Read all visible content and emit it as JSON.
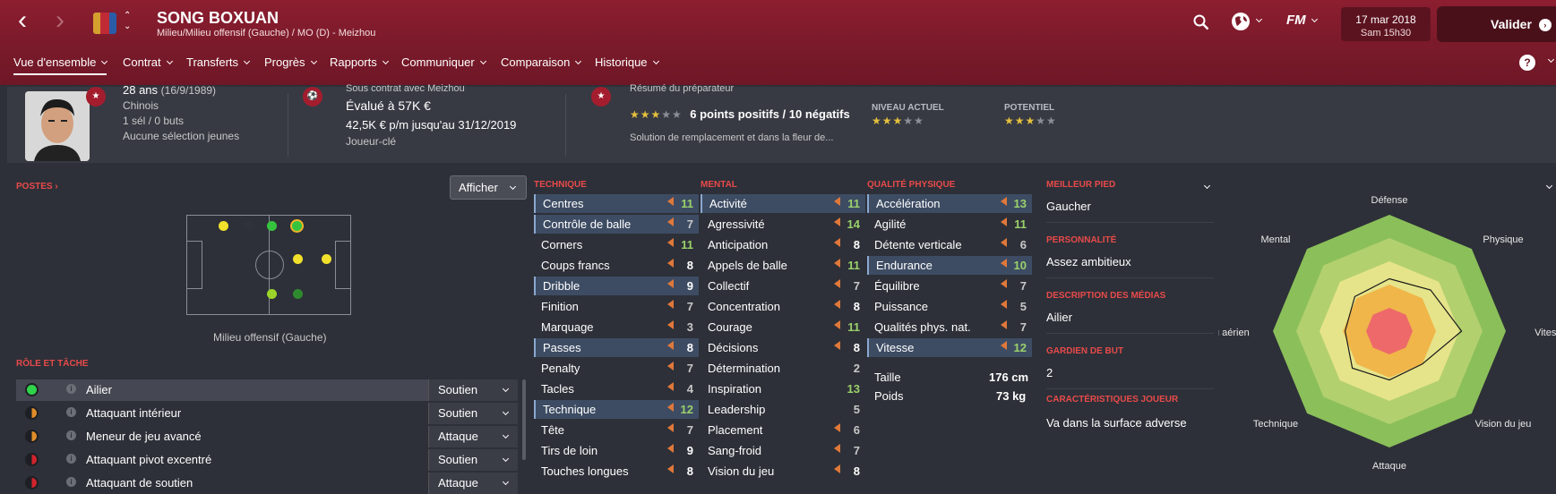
{
  "header": {
    "player_name": "SONG BOXUAN",
    "player_subtitle": "Milieu/Milieu offensif (Gauche) / MO (D) - Meizhou",
    "date": "17 mar 2018",
    "time": "Sam 15h30",
    "valider_label": "Valider",
    "fm_label": "FM",
    "help_label": "?"
  },
  "tabs": [
    "Vue d'ensemble",
    "Contrat",
    "Transferts",
    "Progrès",
    "Rapports",
    "Communiquer",
    "Comparaison",
    "Historique"
  ],
  "summary": {
    "age": "28 ans",
    "birth": "(16/9/1989)",
    "nationality": "Chinois",
    "caps": "1 sél / 0 buts",
    "youth_caps": "Aucune sélection jeunes",
    "contract_label": "Sous contrat avec Meizhou",
    "value": "Évalué à 57K €",
    "wage": "42,5K € p/m jusqu'au 31/12/2019",
    "status": "Joueur-clé",
    "coach_label": "Résumé du préparateur",
    "coach_points": "6 points positifs / 10 négatifs",
    "coach_note": "Solution de remplacement et dans la fleur de...",
    "current_level_label": "NIVEAU ACTUEL",
    "potential_label": "POTENTIEL",
    "coach_stars": 3,
    "current_stars": 3,
    "potential_stars": 3
  },
  "positions": {
    "header": "POSTES",
    "caption": "Milieu offensif (Gauche)",
    "afficher": "Afficher"
  },
  "roles": {
    "header": "RÔLE ET TÂCHE",
    "items": [
      {
        "name": "Ailier",
        "duty": "Soutien",
        "color": "#2fd44a"
      },
      {
        "name": "Attaquant intérieur",
        "duty": "Soutien",
        "color": "#e08c2a"
      },
      {
        "name": "Meneur de jeu avancé",
        "duty": "Attaque",
        "color": "#e08c2a"
      },
      {
        "name": "Attaquant pivot excentré",
        "duty": "Soutien",
        "color": "#d0242e"
      },
      {
        "name": "Attaquant de soutien",
        "duty": "Attaque",
        "color": "#d0242e"
      }
    ]
  },
  "technique": {
    "header": "TECHNIQUE",
    "items": [
      {
        "name": "Centres",
        "value": "11"
      },
      {
        "name": "Contrôle de balle",
        "value": "7"
      },
      {
        "name": "Corners",
        "value": "11"
      },
      {
        "name": "Coups francs",
        "value": "8"
      },
      {
        "name": "Dribble",
        "value": "9"
      },
      {
        "name": "Finition",
        "value": "7"
      },
      {
        "name": "Marquage",
        "value": "3"
      },
      {
        "name": "Passes",
        "value": "8"
      },
      {
        "name": "Penalty",
        "value": "7"
      },
      {
        "name": "Tacles",
        "value": "4"
      },
      {
        "name": "Technique",
        "value": "12"
      },
      {
        "name": "Tête",
        "value": "7"
      },
      {
        "name": "Tirs de loin",
        "value": "9"
      },
      {
        "name": "Touches longues",
        "value": "8"
      }
    ]
  },
  "mental": {
    "header": "MENTAL",
    "items": [
      {
        "name": "Activité",
        "value": "11"
      },
      {
        "name": "Agressivité",
        "value": "14"
      },
      {
        "name": "Anticipation",
        "value": "8"
      },
      {
        "name": "Appels de balle",
        "value": "11"
      },
      {
        "name": "Collectif",
        "value": "7"
      },
      {
        "name": "Concentration",
        "value": "8"
      },
      {
        "name": "Courage",
        "value": "11"
      },
      {
        "name": "Décisions",
        "value": "8"
      },
      {
        "name": "Détermination",
        "value": "2"
      },
      {
        "name": "Inspiration",
        "value": "13"
      },
      {
        "name": "Leadership",
        "value": "5"
      },
      {
        "name": "Placement",
        "value": "6"
      },
      {
        "name": "Sang-froid",
        "value": "7"
      },
      {
        "name": "Vision du jeu",
        "value": "8"
      }
    ]
  },
  "physical": {
    "header": "QUALITÉ PHYSIQUE",
    "items": [
      {
        "name": "Accélération",
        "value": "13"
      },
      {
        "name": "Agilité",
        "value": "11"
      },
      {
        "name": "Détente verticale",
        "value": "6"
      },
      {
        "name": "Endurance",
        "value": "10"
      },
      {
        "name": "Équilibre",
        "value": "7"
      },
      {
        "name": "Puissance",
        "value": "5"
      },
      {
        "name": "Qualités phys. nat.",
        "value": "7"
      },
      {
        "name": "Vitesse",
        "value": "12"
      }
    ],
    "height_label": "Taille",
    "height": "176 cm",
    "weight_label": "Poids",
    "weight": "73 kg"
  },
  "info": {
    "foot_label": "MEILLEUR PIED",
    "foot": "Gaucher",
    "personality_label": "PERSONNALITÉ",
    "personality": "Assez ambitieux",
    "media_label": "DESCRIPTION DES MÉDIAS",
    "media": "Ailier",
    "gk_label": "GARDIEN DE BUT",
    "gk": "2",
    "traits_label": "CARACTÉRISTIQUES JOUEUR",
    "traits": "Va dans la surface adverse"
  },
  "radar": {
    "axes": [
      "Défense",
      "Physique",
      "Vitesse",
      "Vision du jeu",
      "Attaque",
      "Technique",
      "Jeu aérien",
      "Mental"
    ]
  },
  "colors": {
    "accent": "#e84a4a",
    "header_bg": "#7a1a2a",
    "highlight": "#3d4c63",
    "good_value": "#9bd16b"
  }
}
